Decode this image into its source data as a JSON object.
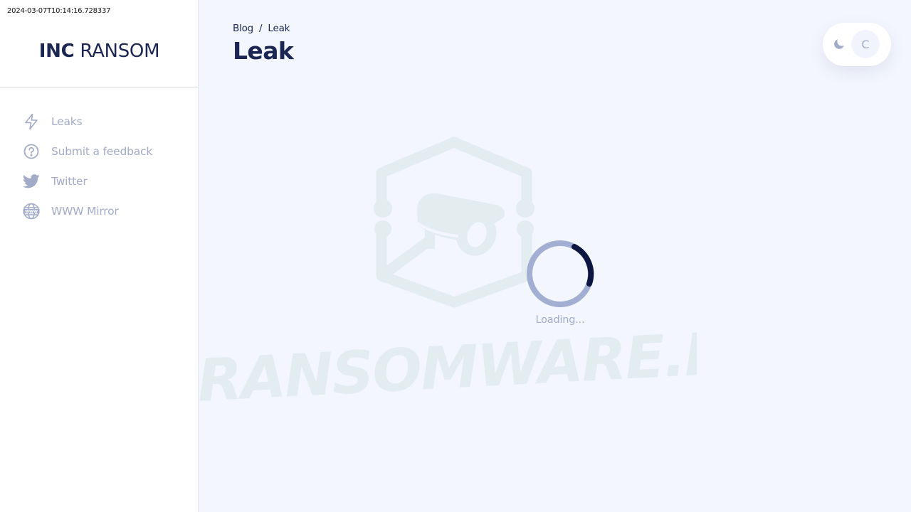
{
  "timestamp": "2024-03-07T10:14:16.728337",
  "brand": {
    "bold": "INC",
    "regular": " RANSOM"
  },
  "sidebar": {
    "items": [
      {
        "label": "Leaks",
        "icon": "lightning-icon"
      },
      {
        "label": "Submit a feedback",
        "icon": "question-circle-icon"
      },
      {
        "label": "Twitter",
        "icon": "twitter-bird-icon"
      },
      {
        "label": "WWW Mirror",
        "icon": "www-globe-icon"
      }
    ]
  },
  "breadcrumb": {
    "parent": "Blog",
    "separator": "/",
    "current": "Leak"
  },
  "page": {
    "title": "Leak"
  },
  "theme_toggle": {
    "knob_letter": "C",
    "icon": "moon-icon"
  },
  "loading": {
    "text": "Loading..."
  },
  "colors": {
    "background": "#f3f6fd",
    "sidebar": "#ffffff",
    "primary_text": "#1b2653",
    "muted_text": "#a2acc8",
    "spinner_track": "#a3aed3",
    "spinner_arc": "#0d1640",
    "watermark": "#e3ecee"
  }
}
